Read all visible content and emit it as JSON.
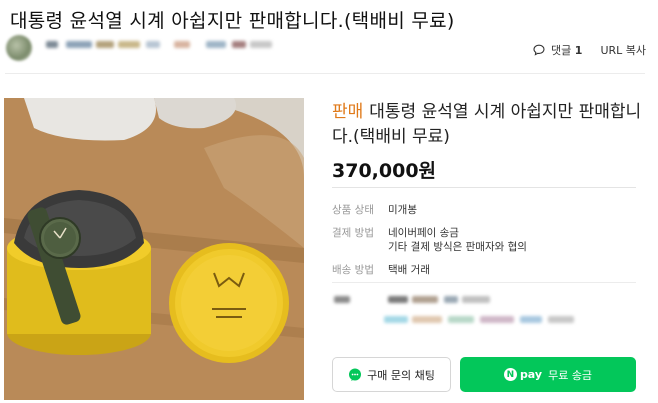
{
  "page": {
    "title": "대통령 윤석열 시계 아쉽지만 판매합니다.(택배비 무료)"
  },
  "meta": {
    "comment_label": "댓글",
    "comment_count": "1",
    "url_copy_label": "URL 복사"
  },
  "product": {
    "status_tag": "판매",
    "name": "대통령 윤석열 시계 아쉽지만 판매합니다.(택배비 무료)",
    "price": "370,000원"
  },
  "info": {
    "condition_label": "상품 상태",
    "condition_value": "미개봉",
    "payment_label": "결제 방법",
    "payment_value_1": "네이버페이 송금",
    "payment_value_2": "기타 결제 방식은 판매자와 협의",
    "shipping_label": "배송 방법",
    "shipping_value": "택배 거래"
  },
  "buttons": {
    "chat_label": "구매 문의 채팅",
    "npay_brand": "pay",
    "npay_n": "N",
    "pay_label": "무료 송금"
  },
  "colors": {
    "sale_tag": "#e07a1a",
    "npay_green": "#03c75a"
  }
}
